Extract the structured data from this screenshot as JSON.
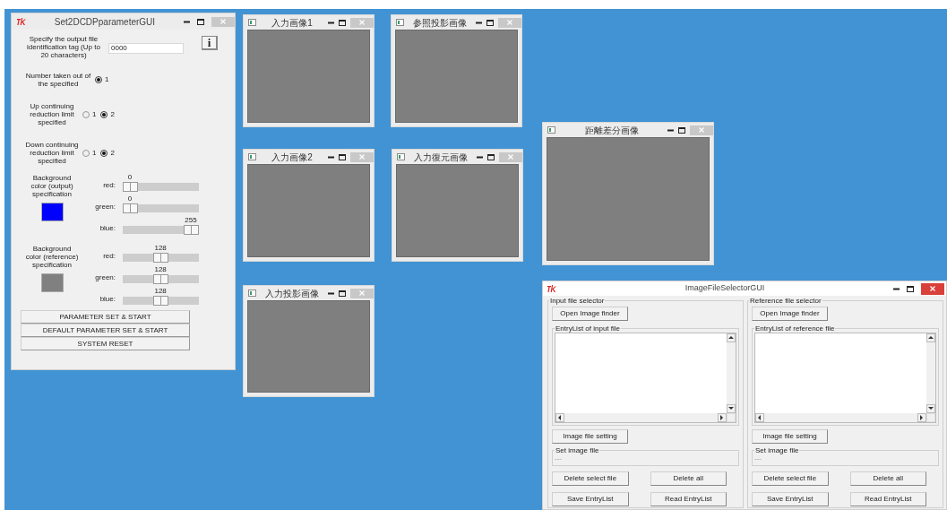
{
  "param_window": {
    "title": "Set2DCDPparameterGUI",
    "output_tag": {
      "label": "Specify the output file identification tag (Up to 20 characters)",
      "value": "0000"
    },
    "info_button": "i",
    "radio_groups": [
      {
        "label": "Number taken out of the specified",
        "options": [
          {
            "label": "1",
            "selected": true
          }
        ]
      },
      {
        "label": "Up continuing reduction limit specified",
        "options": [
          {
            "label": "1",
            "selected": false
          },
          {
            "label": "2",
            "selected": true
          }
        ]
      },
      {
        "label": "Down continuing reduction limit specified",
        "options": [
          {
            "label": "1",
            "selected": false
          },
          {
            "label": "2",
            "selected": true
          }
        ]
      }
    ],
    "color_groups": [
      {
        "label": "Background color (output) specification",
        "sliders": [
          {
            "label": "red:",
            "reading": "0",
            "level": 0
          },
          {
            "label": "green:",
            "reading": "0",
            "level": 0
          },
          {
            "label": "blue:",
            "reading": "255",
            "level": 1
          }
        ]
      },
      {
        "label": "Background color (reference) specification",
        "sliders": [
          {
            "label": "red:",
            "reading": "128",
            "level": 0.502
          },
          {
            "label": "green:",
            "reading": "128",
            "level": 0.502
          },
          {
            "label": "blue:",
            "reading": "128",
            "level": 0.502
          }
        ]
      }
    ],
    "buttons": [
      "PARAMETER SET & START",
      "DEFAULT PARAMETER SET & START",
      "SYSTEM RESET"
    ]
  },
  "image_windows": [
    {
      "title": "入力画像1"
    },
    {
      "title": "参照投影画像"
    },
    {
      "title": "距離差分画像"
    },
    {
      "title": "入力画像2"
    },
    {
      "title": "入力復元画像"
    },
    {
      "title": "入力投影画像"
    }
  ],
  "selector_window": {
    "title": "ImageFileSelectorGUI",
    "panels": [
      {
        "group_label": "Input file selector",
        "open_button": "Open Image finder",
        "list_label": "EntryList of input file",
        "setting_button": "Image file setting",
        "set_image_label": "Set image file",
        "set_image_value": "---",
        "buttons": [
          "Delete select file",
          "Delete all",
          "Save EntryList",
          "Read EntryList"
        ]
      },
      {
        "group_label": "Reference file selector",
        "open_button": "Open Image finder",
        "list_label": "EntryList of reference file",
        "setting_button": "Image file setting",
        "set_image_label": "Set image file",
        "set_image_value": "---",
        "buttons": [
          "Delete select file",
          "Delete all",
          "Save EntryList",
          "Read EntryList"
        ]
      }
    ]
  }
}
